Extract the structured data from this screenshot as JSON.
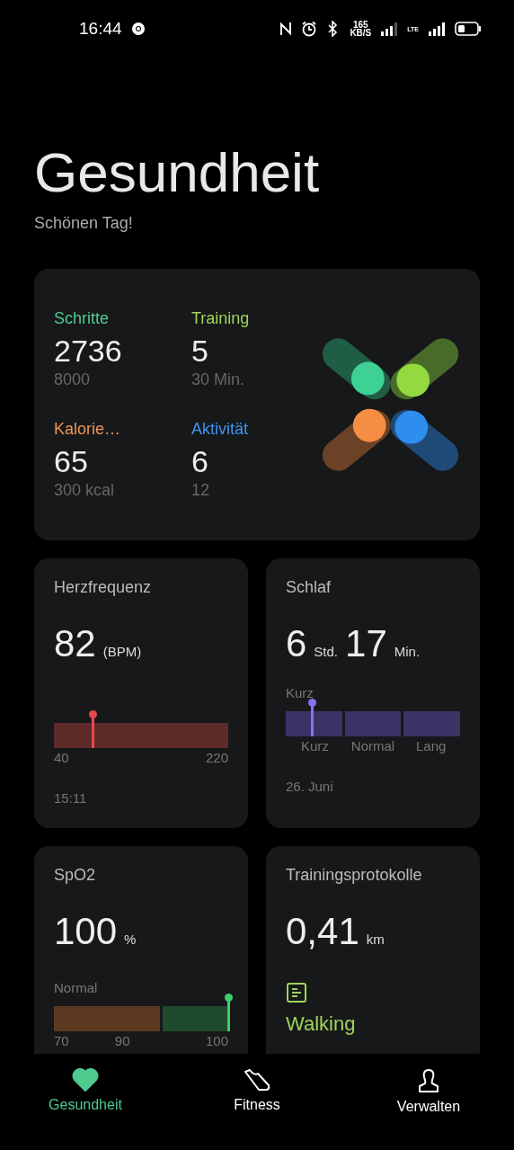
{
  "status_bar": {
    "time": "16:44",
    "speed_value": "165",
    "speed_unit": "KB/S",
    "network": "LTE"
  },
  "header": {
    "title": "Gesundheit",
    "greeting": "Schönen Tag!"
  },
  "summary": {
    "stats": [
      {
        "label": "Schritte",
        "value": "2736",
        "goal": "8000",
        "color": "#4ecb8f"
      },
      {
        "label": "Training",
        "value": "5",
        "goal": "30 Min.",
        "color": "#9ed45a"
      },
      {
        "label": "Kalorie…",
        "value": "65",
        "goal": "300 kcal",
        "color": "#f0955a"
      },
      {
        "label": "Aktivität",
        "value": "6",
        "goal": "12",
        "color": "#3f95f0"
      }
    ]
  },
  "heart_rate": {
    "title": "Herzfrequenz",
    "value": "82",
    "unit": "(BPM)",
    "level": 0.22,
    "min": "40",
    "max": "220",
    "time": "15:11"
  },
  "sleep": {
    "title": "Schlaf",
    "hours": "6",
    "hours_unit": "Std.",
    "minutes": "17",
    "minutes_unit": "Min.",
    "status": "Kurz",
    "level": 0.15,
    "segments": [
      "Kurz",
      "Normal",
      "Lang"
    ],
    "date": "26. Juni"
  },
  "spo2": {
    "title": "SpO2",
    "value": "100",
    "unit": "%",
    "status": "Normal",
    "level": 1.0,
    "segments": [
      {
        "color": "#5c3a22"
      },
      {
        "color": "#1f4a2c"
      }
    ],
    "ticks": [
      "70",
      "90",
      "100"
    ]
  },
  "training_log": {
    "title": "Trainingsprotokolle",
    "value": "0,41",
    "unit": "km",
    "activity": "Walking"
  },
  "nav": [
    {
      "label": "Gesundheit",
      "kind": "heart",
      "selected": true
    },
    {
      "label": "Fitness",
      "kind": "shoe",
      "selected": false
    },
    {
      "label": "Verwalten",
      "kind": "person",
      "selected": false
    }
  ]
}
